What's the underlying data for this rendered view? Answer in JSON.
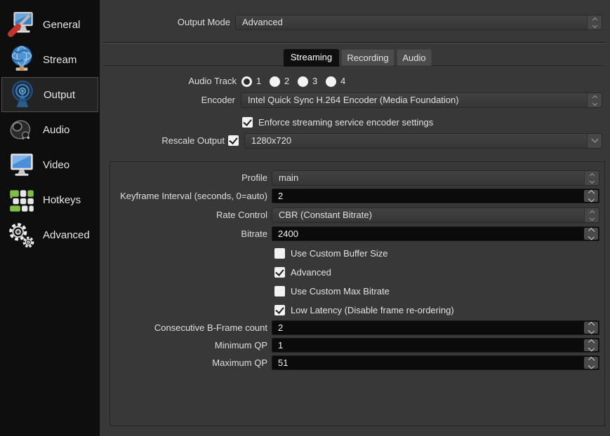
{
  "colors": {
    "icon_blue": "#4aa3e0",
    "icon_green": "#7ec043",
    "icon_red": "#c5342b",
    "panel_bg": "#383838",
    "sidebar_bg": "#0e0e0e"
  },
  "sidebar": {
    "selected": "Output",
    "items": [
      {
        "label": "General",
        "icon": "general-monitor-screwdriver-icon"
      },
      {
        "label": "Stream",
        "icon": "stream-globe-icon"
      },
      {
        "label": "Output",
        "icon": "output-broadcast-icon"
      },
      {
        "label": "Audio",
        "icon": "audio-speaker-icon"
      },
      {
        "label": "Video",
        "icon": "video-monitor-icon"
      },
      {
        "label": "Hotkeys",
        "icon": "hotkeys-keyboard-icon"
      },
      {
        "label": "Advanced",
        "icon": "advanced-gears-icon"
      }
    ]
  },
  "header": {
    "output_mode": {
      "label": "Output Mode",
      "value": "Advanced"
    }
  },
  "tabs": [
    {
      "label": "Streaming",
      "selected": true
    },
    {
      "label": "Recording",
      "selected": false
    },
    {
      "label": "Audio",
      "selected": false
    }
  ],
  "stream": {
    "audio_track": {
      "label": "Audio Track",
      "options": [
        "1",
        "2",
        "3",
        "4"
      ],
      "selected": "1"
    },
    "encoder": {
      "label": "Encoder",
      "value": "Intel Quick Sync H.264 Encoder (Media Foundation)"
    },
    "enforce": {
      "label": "Enforce streaming service encoder settings",
      "checked": true
    },
    "rescale": {
      "label": "Rescale Output",
      "checked": true,
      "value": "1280x720"
    }
  },
  "group": {
    "profile": {
      "label": "Profile",
      "value": "main"
    },
    "keyframe": {
      "label": "Keyframe Interval (seconds, 0=auto)",
      "value": "2"
    },
    "rate_control": {
      "label": "Rate Control",
      "value": "CBR (Constant Bitrate)"
    },
    "bitrate": {
      "label": "Bitrate",
      "value": "2400"
    },
    "buffer_size": {
      "label": "Use Custom Buffer Size",
      "checked": false
    },
    "advanced": {
      "label": "Advanced",
      "checked": true
    },
    "max_bitrate": {
      "label": "Use Custom Max Bitrate",
      "checked": false
    },
    "low_latency": {
      "label": "Low Latency (Disable frame re-ordering)",
      "checked": true
    },
    "bframes": {
      "label": "Consecutive B-Frame count",
      "value": "2"
    },
    "min_qp": {
      "label": "Minimum QP",
      "value": "1"
    },
    "max_qp": {
      "label": "Maximum QP",
      "value": "51"
    }
  }
}
